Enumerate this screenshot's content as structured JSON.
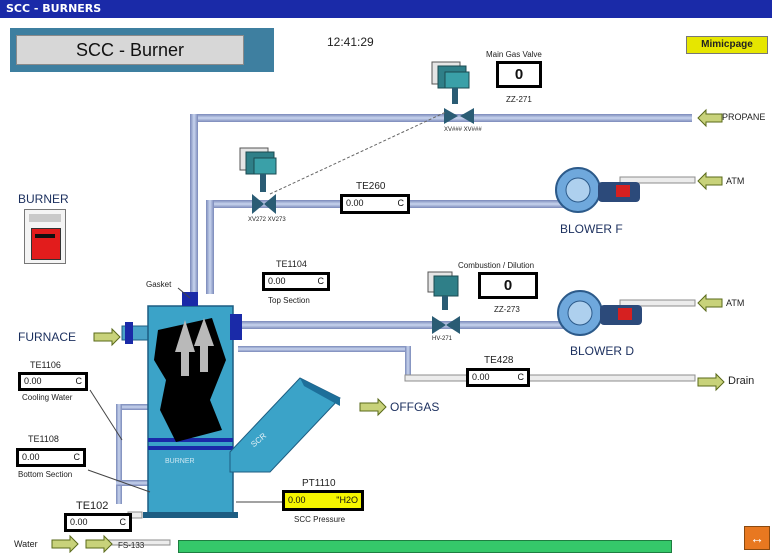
{
  "window": {
    "title": "SCC - BURNERS"
  },
  "header": {
    "title": "SCC - Burner",
    "time": "12:41:29",
    "mimic_button": "Mimicpage"
  },
  "labels": {
    "burner": "BURNER",
    "furnace": "FURNACE",
    "offgas": "OFFGAS",
    "blower_f": "BLOWER  F",
    "blower_d": "BLOWER  D",
    "propane": "PROPANE",
    "atm_f": "ATM",
    "atm_d": "ATM",
    "drain": "Drain",
    "water": "Water",
    "fs": "FS-133",
    "gasket": "Gasket",
    "top_section": "Top Section",
    "cooling_water": "Cooling Water",
    "bottom_section": "Bottom Section",
    "scc_pressure": "SCC Pressure",
    "main_gas_valve": "Main Gas Valve",
    "combustion_dilution": "Combustion / Dilution",
    "zz271": "ZZ-271",
    "zz273": "ZZ-273",
    "valve_main_tags": "XV###  XV###",
    "valve_f_tags": "XV272  XV273",
    "valve_d_tag": "HV-271"
  },
  "instruments": {
    "te260": {
      "tag": "TE260",
      "value": "0.00",
      "unit": "C"
    },
    "te1104": {
      "tag": "TE1104",
      "value": "0.00",
      "unit": "C"
    },
    "te1106": {
      "tag": "TE1106",
      "value": "0.00",
      "unit": "C"
    },
    "te1108": {
      "tag": "TE1108",
      "value": "0.00",
      "unit": "C"
    },
    "te102": {
      "tag": "TE102",
      "value": "0.00",
      "unit": "C"
    },
    "te428": {
      "tag": "TE428",
      "value": "0.00",
      "unit": "C"
    },
    "pt1110": {
      "tag": "PT1110",
      "value": "0.00",
      "unit": "\"H2O"
    }
  },
  "valves": {
    "main_gas": {
      "position": "0"
    },
    "combustion": {
      "position": "0"
    }
  },
  "colors": {
    "title_bar": "#1a2aa8",
    "vessel": "#3ba3c8",
    "pipe": "#b8c6e4",
    "pressure_box": "#f5f500",
    "status_bar": "#35c86a",
    "mimic_button": "#e6e600"
  },
  "icons": [
    "burner-panel-icon",
    "blower-icon",
    "valve-icon",
    "arrow-icon",
    "flame-icon"
  ]
}
